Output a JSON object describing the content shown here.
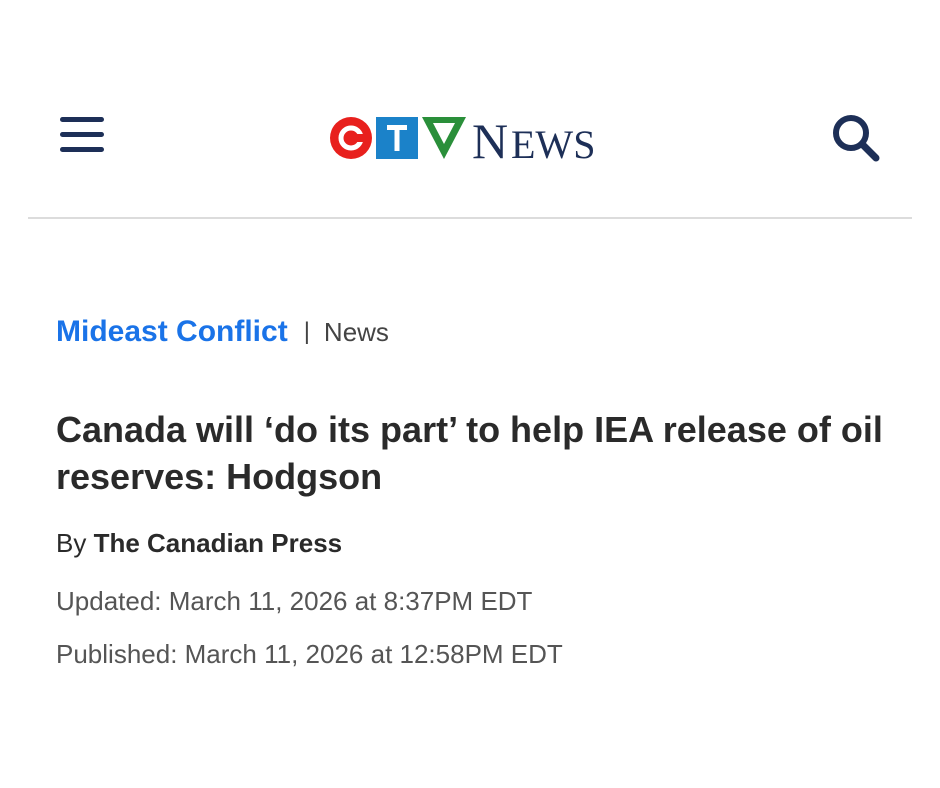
{
  "header": {
    "menu_icon": "hamburger-menu-icon",
    "logo": {
      "letters": [
        "C",
        "T",
        "V"
      ],
      "wordmark": "NEWS",
      "colors": {
        "red": "#e8201d",
        "blue": "#1b82c9",
        "green": "#2a8f3a",
        "navy": "#1d2f57"
      }
    },
    "search_icon": "search-icon"
  },
  "article": {
    "category": "Mideast Conflict",
    "separator": "|",
    "section": "News",
    "headline": "Canada will ‘do its part’ to help IEA release of oil reserves: Hodgson",
    "byline_prefix": "By",
    "author": "The Canadian Press",
    "updated": "Updated: March 11, 2026 at 8:37PM EDT",
    "published": "Published: March 11, 2026 at 12:58PM EDT"
  },
  "colors": {
    "link_blue": "#1a73e8",
    "headline": "#2a2a2a",
    "muted": "#555555",
    "divider": "#dcdcdc"
  }
}
